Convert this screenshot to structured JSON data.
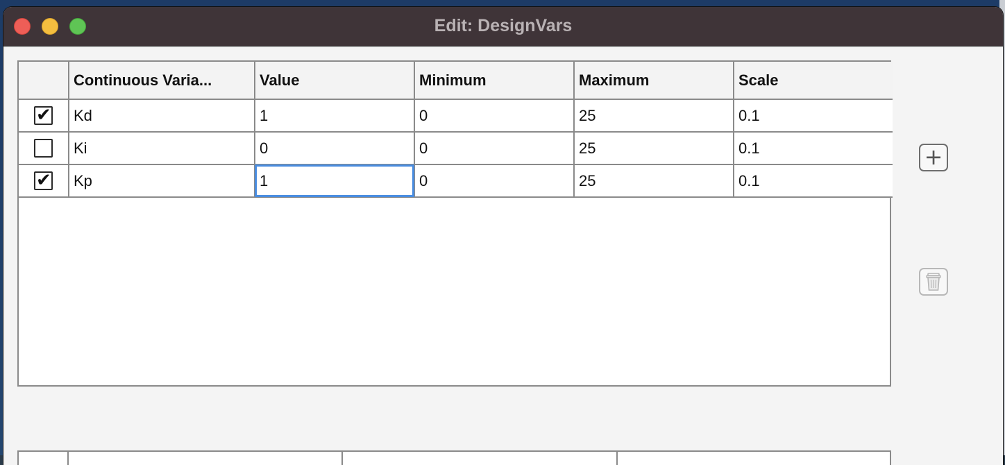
{
  "window": {
    "title": "Edit: DesignVars"
  },
  "table": {
    "headers": [
      "",
      "Continuous Varia...",
      "Value",
      "Minimum",
      "Maximum",
      "Scale"
    ],
    "rows": [
      {
        "checked": true,
        "name": "Kd",
        "value": "1",
        "min": "0",
        "max": "25",
        "scale": "0.1"
      },
      {
        "checked": false,
        "name": "Ki",
        "value": "0",
        "min": "0",
        "max": "25",
        "scale": "0.1"
      },
      {
        "checked": true,
        "name": "Kp",
        "value": "1",
        "min": "0",
        "max": "25",
        "scale": "0.1"
      }
    ]
  },
  "buttons": {
    "add_icon": "plus-icon",
    "delete_icon": "trash-icon"
  },
  "colors": {
    "titlebar": "#3f3438",
    "selection_outline": "#4a8de0"
  }
}
